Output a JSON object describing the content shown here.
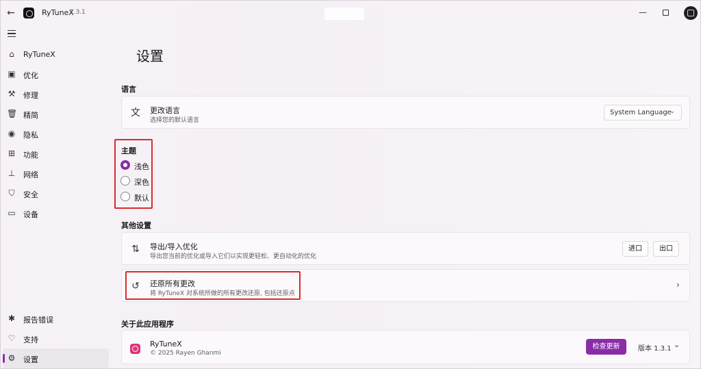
{
  "titlebar": {
    "app_name": "RyTuneX",
    "version": "1.3.1",
    "back_icon": "arrow-left-icon",
    "minimize_glyph": "—"
  },
  "sidebar": {
    "items": [
      {
        "label": "RyTuneX",
        "icon": "home-icon",
        "glyph": "⌂"
      },
      {
        "label": "优化",
        "icon": "dashboard-icon",
        "glyph": "▣"
      },
      {
        "label": "修理",
        "icon": "wrench-icon",
        "glyph": "⚒"
      },
      {
        "label": "精简",
        "icon": "trash-icon",
        "glyph": "🗑"
      },
      {
        "label": "隐私",
        "icon": "eye-icon",
        "glyph": "◉"
      },
      {
        "label": "功能",
        "icon": "apps-icon",
        "glyph": "⊞"
      },
      {
        "label": "网络",
        "icon": "network-icon",
        "glyph": "⊥"
      },
      {
        "label": "安全",
        "icon": "shield-icon",
        "glyph": "⛉"
      },
      {
        "label": "设备",
        "icon": "laptop-icon",
        "glyph": "▭"
      }
    ],
    "bottom_items": [
      {
        "label": "报告错误",
        "icon": "bug-icon",
        "glyph": "✱"
      },
      {
        "label": "支持",
        "icon": "gift-icon",
        "glyph": "♡"
      },
      {
        "label": "设置",
        "icon": "gear-icon",
        "glyph": "⚙"
      }
    ]
  },
  "main": {
    "page_title": "设置",
    "language": {
      "section": "语言",
      "title": "更改语言",
      "desc": "选择您的默认语言",
      "select_value": "System Language",
      "icon_glyph": "文"
    },
    "theme": {
      "section": "主题",
      "options": [
        {
          "label": "浅色",
          "checked": true
        },
        {
          "label": "深色",
          "checked": false
        },
        {
          "label": "默认",
          "checked": false
        }
      ]
    },
    "other": {
      "section": "其他设置",
      "export_title": "导出/导入优化",
      "export_desc": "导出您当前的优化或导入它们以实现更轻松、更自动化的优化",
      "import_btn": "进口",
      "export_btn": "出口",
      "revert_title": "还原所有更改",
      "revert_desc": "将 RyTuneX 对系统所做的所有更改还原, 包括还原点"
    },
    "about": {
      "section": "关于此应用程序",
      "name": "RyTuneX",
      "copyright": "© 2025 Rayen Ghanmi",
      "check_update": "检查更新",
      "version_label": "版本 1.3.1"
    }
  },
  "colors": {
    "accent": "#8a2ca7",
    "highlight_box": "#d92b2b",
    "app_logo": "#e0337a"
  }
}
